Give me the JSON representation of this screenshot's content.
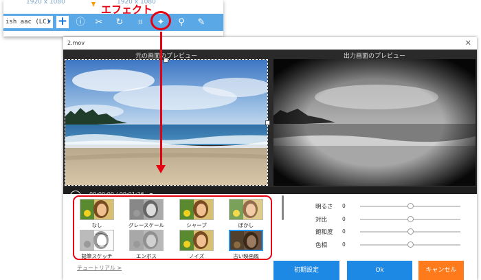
{
  "toolbar": {
    "resolution_left": "1920 x 1080",
    "resolution_right": "1920 x 1080",
    "format_value": "ish aac (LC)",
    "add_symbol": "+",
    "tools": [
      "info-icon",
      "scissors-icon",
      "rotate-icon",
      "crop-icon",
      "magic-wand-icon",
      "watermark-icon",
      "edit-icon"
    ],
    "callout_label": "エフェクト"
  },
  "window": {
    "title": "2.mov",
    "original_preview_label": "元の画面のプレビュー",
    "output_preview_label": "出力画面のプレビュー",
    "time_current": "00:00:00",
    "time_separator": "/",
    "time_total": "00:01:26",
    "playback_progress": 0
  },
  "effects": [
    {
      "label": "なし",
      "style": "color"
    },
    {
      "label": "グレースケール",
      "style": "gray"
    },
    {
      "label": "シャープ",
      "style": "color"
    },
    {
      "label": "ぼかし",
      "style": "blur"
    },
    {
      "label": "鉛筆スケッチ",
      "style": "sketch"
    },
    {
      "label": "エンボス",
      "style": "emboss"
    },
    {
      "label": "ノイズ",
      "style": "color"
    },
    {
      "label": "古い映画風",
      "style": "old",
      "selected": true
    }
  ],
  "adjustments": [
    {
      "label": "明るさ",
      "value": "0",
      "level": 0.5
    },
    {
      "label": "対比",
      "value": "0",
      "level": 0.5
    },
    {
      "label": "飽和度",
      "value": "0",
      "level": 0.5
    },
    {
      "label": "色相",
      "value": "0",
      "level": 0.5
    }
  ],
  "footer": {
    "tutorial_link": "チュートリアル >",
    "reset_button": "初期設定",
    "ok_button": "Ok",
    "cancel_button": "キャンセル"
  },
  "colors": {
    "accent_blue": "#1e88e5",
    "callout_red": "#e60012",
    "cancel_orange": "#ff7a1a",
    "toolbar_blue": "#5aa9e6"
  }
}
